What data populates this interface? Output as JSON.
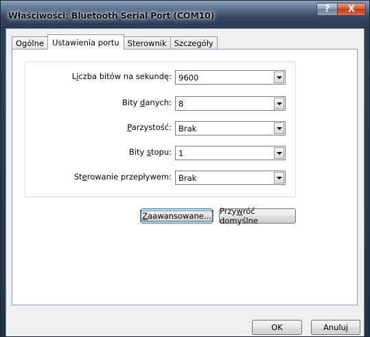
{
  "window": {
    "title": "Właściwości: Bluetooth Serial Port (COM10)",
    "help_label": "?",
    "close_label": "X"
  },
  "tabs": [
    {
      "label": "Ogólne",
      "active": false
    },
    {
      "label": "Ustawienia portu",
      "active": true
    },
    {
      "label": "Sterownik",
      "active": false
    },
    {
      "label": "Szczegóły",
      "active": false
    }
  ],
  "fields": {
    "bits_per_second": {
      "label_pre": "L",
      "label_u": "i",
      "label_post": "czba bitów na sekundę:",
      "value": "9600"
    },
    "data_bits": {
      "label_pre": "Bity ",
      "label_u": "d",
      "label_post": "anych:",
      "value": "8"
    },
    "parity": {
      "label_pre": "",
      "label_u": "P",
      "label_post": "arzystość:",
      "value": "Brak"
    },
    "stop_bits": {
      "label_pre": "Bity ",
      "label_u": "s",
      "label_post": "topu:",
      "value": "1"
    },
    "flow_control": {
      "label_pre": "St",
      "label_u": "e",
      "label_post": "rowanie przepływem:",
      "value": "Brak"
    }
  },
  "buttons": {
    "advanced": {
      "pre": "",
      "u": "Z",
      "post": "aawansowane..."
    },
    "restore": {
      "pre": "Przy",
      "u": "w",
      "post": "róć domyślne"
    },
    "ok": "OK",
    "cancel": "Anuluj"
  }
}
